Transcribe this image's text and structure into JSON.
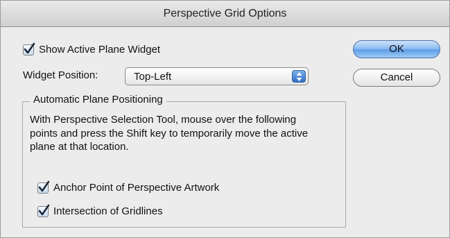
{
  "window": {
    "title": "Perspective Grid Options"
  },
  "options": {
    "show_widget": {
      "label": "Show Active Plane Widget",
      "checked": true
    },
    "widget_position": {
      "label": "Widget Position:",
      "value": "Top-Left"
    }
  },
  "buttons": {
    "ok": "OK",
    "cancel": "Cancel"
  },
  "auto_plane": {
    "title": "Automatic Plane Positioning",
    "description": "With Perspective Selection Tool, mouse over the following points and press the Shift key to temporarily move the active plane at that location.",
    "anchor_point": {
      "label": "Anchor Point of Perspective Artwork",
      "checked": true
    },
    "gridlines": {
      "label": "Intersection of Gridlines",
      "checked": true
    }
  },
  "icons": {
    "checkmark": "checkmark-icon",
    "stepper": "up-down-arrows-icon"
  },
  "colors": {
    "accent": "#5f9fe8",
    "window_bg": "#ececec"
  }
}
